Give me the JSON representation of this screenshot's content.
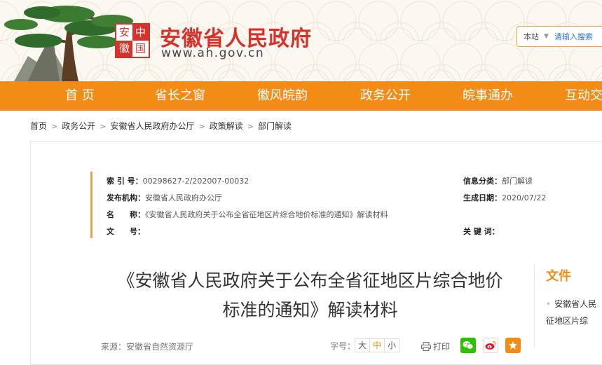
{
  "header": {
    "seal_chars": [
      "安",
      "中",
      "徽",
      "国"
    ],
    "site_name": "安徽省人民政府",
    "site_url": "www.ah.gov.cn",
    "search": {
      "scope": "本站",
      "placeholder": "请输入搜索"
    }
  },
  "nav": {
    "items": [
      {
        "label": "首 页"
      },
      {
        "label": "省长之窗"
      },
      {
        "label": "徽风皖韵"
      },
      {
        "label": "政务公开"
      },
      {
        "label": "皖事通办"
      },
      {
        "label": "互动交"
      }
    ]
  },
  "breadcrumb": {
    "items": [
      "首页",
      "政务公开",
      "安徽省人民政府办公厅",
      "政策解读",
      "部门解读"
    ],
    "separator": ">"
  },
  "meta": {
    "index_key": "索 引 号：",
    "index_val": "00298627-2/202007-00032",
    "category_key": "信息分类：",
    "category_val": "部门解读",
    "issuer_key": "发布机构：",
    "issuer_val": "安徽省人民政府办公厅",
    "date_key": "生成日期：",
    "date_val": "2020/07/22",
    "name_key": "名　　称：",
    "name_val": "《安徽省人民政府关于公布全省征地区片综合地价标准的通知》解读材料",
    "docno_key": "文　　号：",
    "docno_val": "",
    "keywords_key": "关 键 词：",
    "keywords_val": ""
  },
  "article": {
    "title_line1": "《安徽省人民政府关于公布全省征地区片综合地价",
    "title_line2": "标准的通知》解读材料",
    "source": "来源：安徽省自然资源厅",
    "font_size_label": "字号：",
    "font_sizes": [
      "大",
      "中",
      "小"
    ],
    "print_label": "打印"
  },
  "side": {
    "title": "文件",
    "item_line1": "安徽省人民",
    "item_line2": "征地区片综"
  },
  "colors": {
    "brand_red": "#d6322b",
    "nav_orange": "#f28c16",
    "wechat_green": "#2dc100",
    "weibo_red": "#e6162d",
    "fav_orange": "#f28c16"
  }
}
